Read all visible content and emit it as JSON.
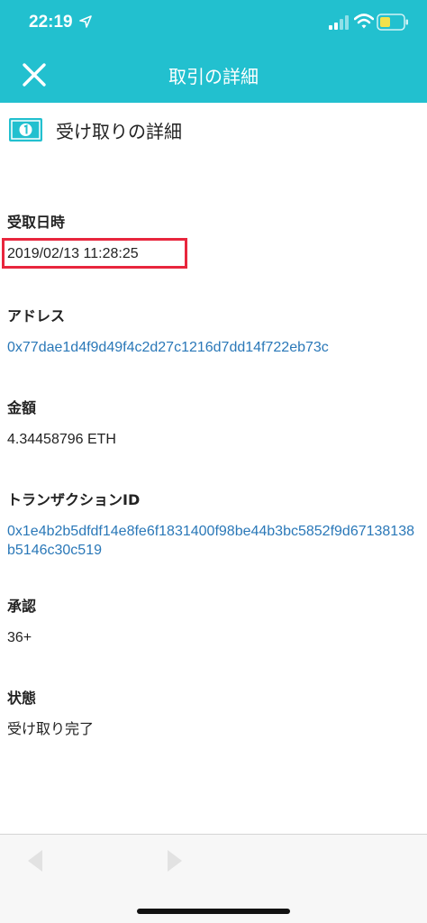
{
  "status_bar": {
    "time": "22:19",
    "icons": [
      "location-arrow-icon",
      "cellular-signal-icon",
      "wifi-icon",
      "battery-icon"
    ]
  },
  "nav": {
    "title": "取引の詳細",
    "close_icon": "close-icon"
  },
  "section": {
    "icon": "money-bill-icon",
    "title": "受け取りの詳細"
  },
  "fields": {
    "date": {
      "label": "受取日時",
      "value": "2019/02/13 11:28:25"
    },
    "address": {
      "label": "アドレス",
      "value": "0x77dae1d4f9d49f4c2d27c1216d7dd14f722eb73c"
    },
    "amount": {
      "label": "金額",
      "value": "4.34458796 ETH"
    },
    "txid": {
      "label": "トランザクションID",
      "value": "0x1e4b2b5dfdf14e8fe6f1831400f98be44b3bc5852f9d67138138b5146c30c519"
    },
    "confirmations": {
      "label": "承認",
      "value": "36+"
    },
    "status": {
      "label": "状態",
      "value": "受け取り完了"
    }
  },
  "colors": {
    "header": "#22c0cf",
    "link": "#2a78b8",
    "highlight": "#e8263d"
  },
  "toolbar": {
    "icons": [
      "back-arrow-icon",
      "forward-arrow-icon"
    ]
  }
}
